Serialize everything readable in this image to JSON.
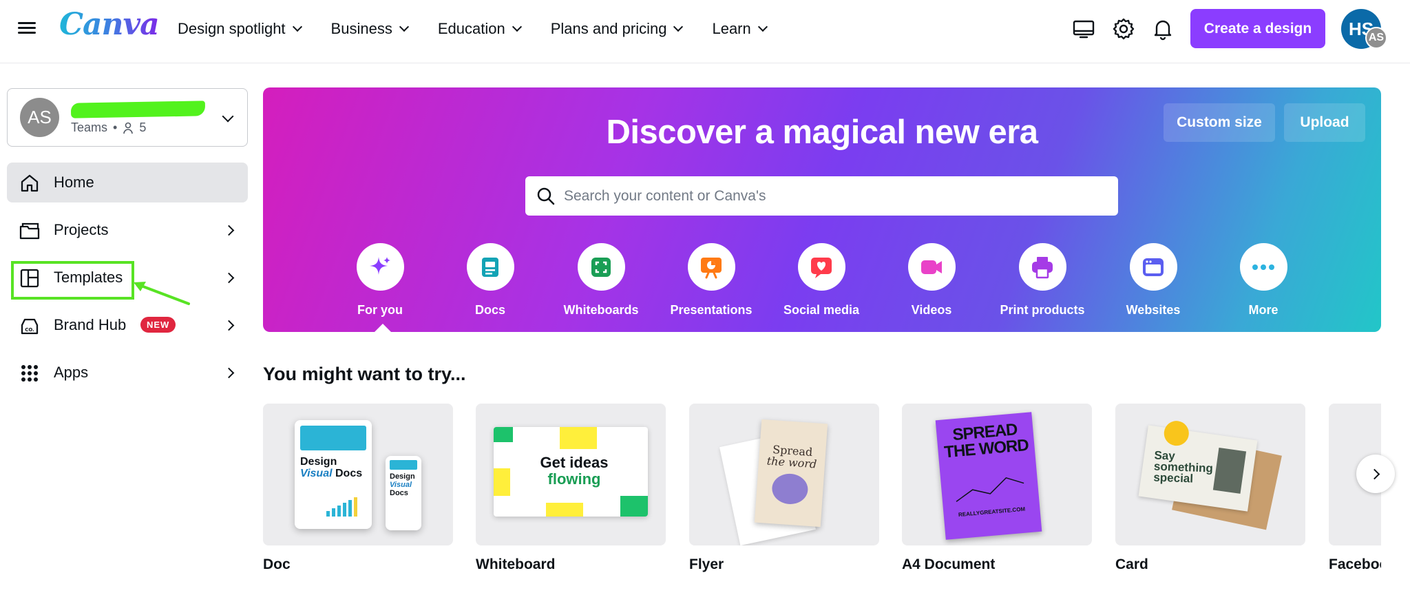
{
  "header": {
    "logo": "Canva",
    "nav": [
      "Design spotlight",
      "Business",
      "Education",
      "Plans and pricing",
      "Learn"
    ],
    "create_label": "Create a design",
    "user_initials": "HS",
    "team_initials": "AS",
    "accent": "#8b3dff"
  },
  "sidebar": {
    "team": {
      "initials": "AS",
      "name": "… ",
      "type": "Teams",
      "members": "5"
    },
    "items": [
      {
        "label": "Home",
        "icon": "home-icon"
      },
      {
        "label": "Projects",
        "icon": "folder-icon"
      },
      {
        "label": "Templates",
        "icon": "templates-icon"
      },
      {
        "label": "Brand Hub",
        "icon": "brand-hub-icon",
        "badge": "NEW"
      },
      {
        "label": "Apps",
        "icon": "apps-grid-icon"
      }
    ]
  },
  "hero": {
    "title": "Discover a magical new era",
    "custom_size": "Custom size",
    "upload": "Upload",
    "search_placeholder": "Search your content or Canva's",
    "categories": [
      {
        "label": "For you",
        "icon": "sparkle-icon",
        "color": "#8b3dff"
      },
      {
        "label": "Docs",
        "icon": "doc-icon",
        "color": "#13a3b5"
      },
      {
        "label": "Whiteboards",
        "icon": "whiteboard-icon",
        "color": "#1a9e55"
      },
      {
        "label": "Presentations",
        "icon": "presentation-icon",
        "color": "#ff7a14"
      },
      {
        "label": "Social media",
        "icon": "heart-icon",
        "color": "#ff3b4b"
      },
      {
        "label": "Videos",
        "icon": "video-icon",
        "color": "#e942c8"
      },
      {
        "label": "Print products",
        "icon": "printer-icon",
        "color": "#a53be6"
      },
      {
        "label": "Websites",
        "icon": "website-icon",
        "color": "#5b5ef0"
      },
      {
        "label": "More",
        "icon": "more-icon",
        "color": "#2cb3e0"
      }
    ]
  },
  "suggestions": {
    "title": "You might want to try...",
    "cards": [
      {
        "label": "Doc",
        "thumb_text": [
          "Design",
          "Visual",
          "Docs"
        ]
      },
      {
        "label": "Whiteboard",
        "thumb_text": [
          "Get ideas",
          "flowing"
        ]
      },
      {
        "label": "Flyer",
        "thumb_text": [
          "Spread",
          "the word"
        ]
      },
      {
        "label": "A4 Document",
        "thumb_text": [
          "SPREAD",
          "THE WORD",
          "REALLYGREATSITE.COM"
        ]
      },
      {
        "label": "Card",
        "thumb_text": [
          "Say",
          "something",
          "special"
        ]
      },
      {
        "label": "Facebook post",
        "thumb_text": []
      }
    ]
  }
}
